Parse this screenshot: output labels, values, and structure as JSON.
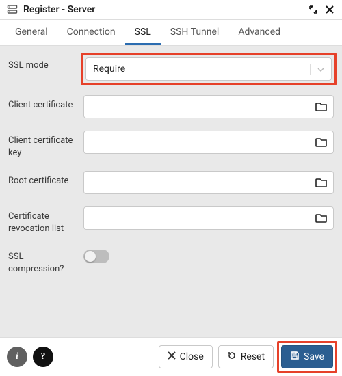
{
  "header": {
    "title": "Register - Server"
  },
  "tabs": [
    {
      "label": "General"
    },
    {
      "label": "Connection"
    },
    {
      "label": "SSL"
    },
    {
      "label": "SSH Tunnel"
    },
    {
      "label": "Advanced"
    }
  ],
  "active_tab": 2,
  "fields": {
    "ssl_mode": {
      "label": "SSL mode",
      "value": "Require"
    },
    "client_cert": {
      "label": "Client certificate",
      "value": ""
    },
    "client_cert_key": {
      "label": "Client certificate key",
      "value": ""
    },
    "root_cert": {
      "label": "Root certificate",
      "value": ""
    },
    "crl": {
      "label": "Certificate revocation list",
      "value": ""
    },
    "ssl_compression": {
      "label": "SSL compression?",
      "value": false
    }
  },
  "footer": {
    "close": "Close",
    "reset": "Reset",
    "save": "Save"
  }
}
